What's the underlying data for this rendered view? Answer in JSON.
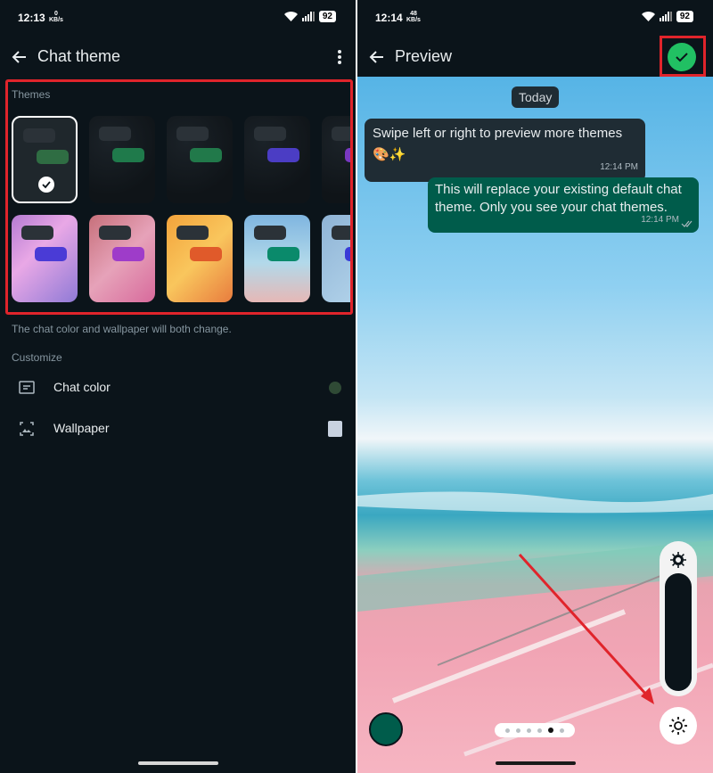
{
  "left": {
    "status": {
      "time": "12:13",
      "speed_value": "0",
      "speed_unit": "KB/s",
      "battery": "92"
    },
    "header": {
      "title": "Chat theme"
    },
    "themes_label": "Themes",
    "themes_row1": [
      {
        "bubble": "#2f6d43",
        "selected": true
      },
      {
        "bubble": "#1f7a4b",
        "selected": false
      },
      {
        "bubble": "#21794a",
        "selected": false
      },
      {
        "bubble": "#4b3dc4",
        "selected": false
      },
      {
        "bubble": "#7a38c1",
        "selected": false
      }
    ],
    "themes_row2": [
      {
        "bubble": "#4a3bd6",
        "bg": "linear-gradient(135deg,#b37ad1,#e9a8e6 40%,#8f7ad6)"
      },
      {
        "bubble": "#9e3cc9",
        "bg": "linear-gradient(135deg,#c7707a,#e6a2b9 50%,#d86a9c)"
      },
      {
        "bubble": "#e05a2a",
        "bg": "linear-gradient(135deg,#f3a33b,#f9c65d 50%,#e87c3e)"
      },
      {
        "bubble": "#0a8a6b",
        "bg": "linear-gradient(180deg,#7fb5e0,#b2d9ea 55%,#e6b8b6)"
      },
      {
        "bubble": "#3a3ad6",
        "bg": "linear-gradient(135deg,#8fb4d6,#b9d9ee)"
      }
    ],
    "info": "The chat color and wallpaper will both change.",
    "customize_label": "Customize",
    "chat_color_label": "Chat color",
    "chat_color_value": "#2f4a35",
    "wallpaper_label": "Wallpaper",
    "wallpaper_value": "#c8d2e0"
  },
  "right": {
    "status": {
      "time": "12:14",
      "speed_value": "48",
      "speed_unit": "KB/s",
      "battery": "92"
    },
    "header": {
      "title": "Preview"
    },
    "date_chip": "Today",
    "incoming": {
      "text": "Swipe left or right to preview more themes 🎨✨",
      "time": "12:14 PM"
    },
    "outgoing": {
      "text": "This will replace your existing default chat theme. Only you see your chat themes.",
      "time": "12:14 PM"
    },
    "page_dots": 6,
    "active_dot": 5
  },
  "colors": {
    "accent_green": "#21c063",
    "highlight_red": "#e0242b",
    "bubble_out": "#005c4b",
    "bubble_in": "#1f2c34"
  }
}
